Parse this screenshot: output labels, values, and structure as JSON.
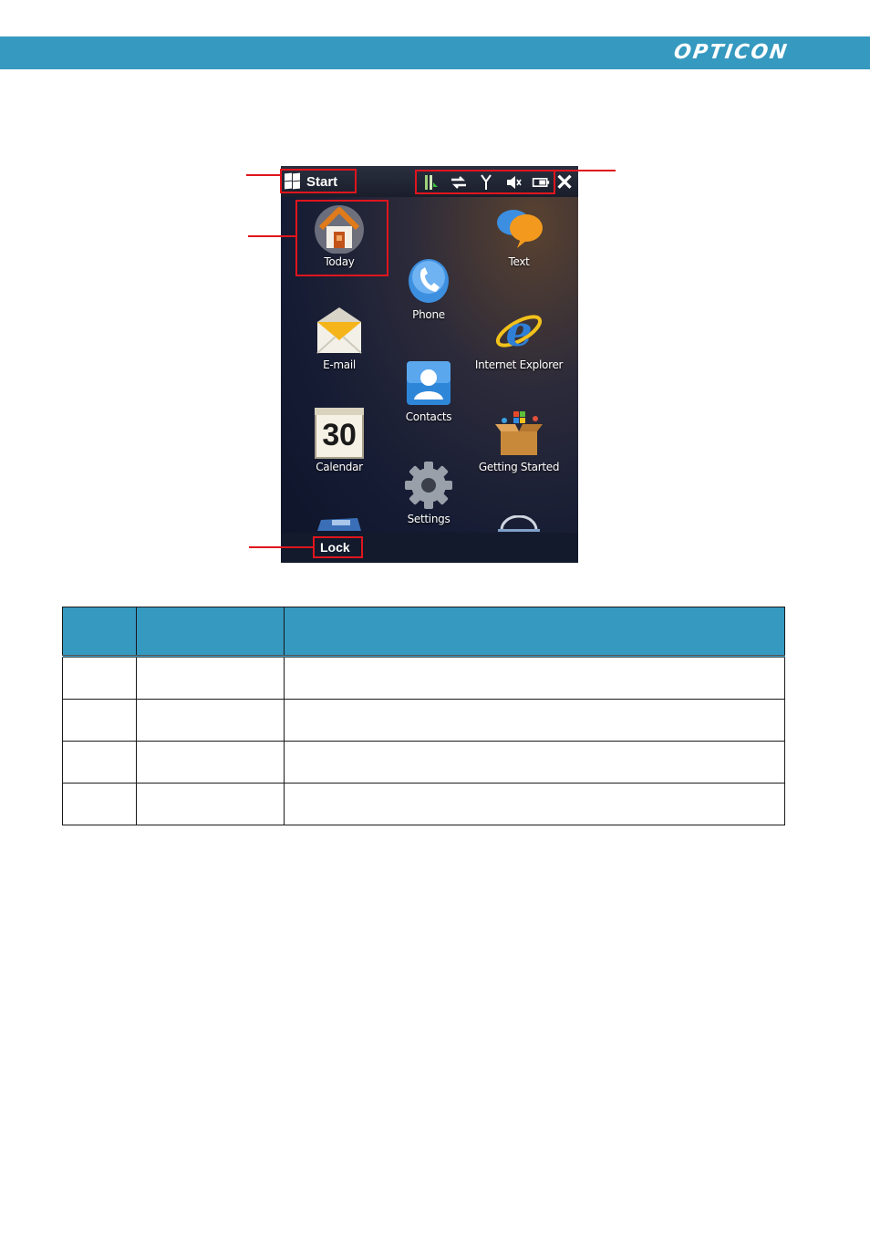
{
  "header": {
    "brand": "OPTICON",
    "bar_color": "#3599c0"
  },
  "screenshot": {
    "top_bar": {
      "start_label": "Start",
      "status_icons": [
        "signal-bars-icon",
        "data-sync-arrows-icon",
        "antenna-icon",
        "speaker-muted-icon",
        "battery-icon"
      ],
      "close_icon": "close-icon"
    },
    "tiles": [
      {
        "label": "Today",
        "icon": "house-icon"
      },
      {
        "label": "Text",
        "icon": "chat-bubbles-icon"
      },
      {
        "label": "Phone",
        "icon": "phone-handset-icon"
      },
      {
        "label": "E-mail",
        "icon": "envelope-icon"
      },
      {
        "label": "Internet Explorer",
        "icon": "internet-explorer-icon"
      },
      {
        "label": "Contacts",
        "icon": "contact-card-icon"
      },
      {
        "label": "Calendar",
        "icon": "calendar-icon",
        "day": "30"
      },
      {
        "label": "Getting Started",
        "icon": "gift-box-icon"
      },
      {
        "label": "Settings",
        "icon": "gear-icon"
      }
    ],
    "bottom_bar": {
      "lock_label": "Lock"
    }
  },
  "callout_color": "#e0151d",
  "table": {
    "header_color": "#3599c0",
    "columns": [
      "",
      "",
      ""
    ],
    "rows": [
      [
        "",
        "",
        ""
      ],
      [
        "",
        "",
        ""
      ],
      [
        "",
        "",
        ""
      ],
      [
        "",
        "",
        ""
      ]
    ]
  }
}
